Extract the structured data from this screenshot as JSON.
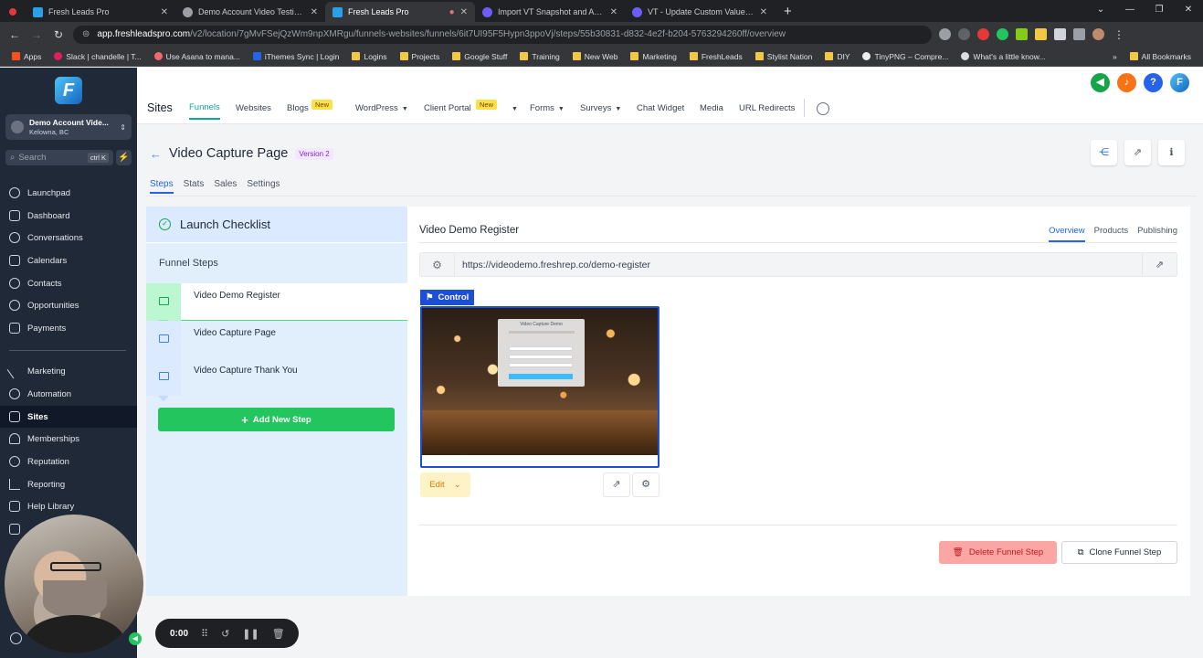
{
  "browser": {
    "tabs": [
      {
        "title": "Fresh Leads Pro",
        "active": false,
        "color": "#29a0e8"
      },
      {
        "title": "Demo Account Video Testimoni",
        "active": false,
        "color": "#9aa0a6"
      },
      {
        "title": "Fresh Leads Pro",
        "active": true,
        "color": "#29a0e8"
      },
      {
        "title": "Import VT Snapshot and Add t",
        "active": false,
        "color": "#6d5cf6"
      },
      {
        "title": "VT - Update Custom Values and",
        "active": false,
        "color": "#6d5cf6"
      }
    ],
    "url_host": "app.freshleadspro.com",
    "url_path": "/v2/location/7gMvFSejQzWm9npXMRgu/funnels-websites/funnels/6it7UI95F5Hypn3ppoVj/steps/55b30831-d832-4e2f-b204-5763294260ff/overview",
    "bookmarks": [
      "Apps",
      "Slack | chandelle | T...",
      "Use Asana to mana...",
      "iThemes Sync | Login",
      "Logins",
      "Projects",
      "Google Stuff",
      "Training",
      "New Web",
      "Marketing",
      "FreshLeads",
      "Stylist Nation",
      "DIY",
      "TinyPNG – Compre...",
      "What's a little know..."
    ],
    "bookmarks_right": "All Bookmarks"
  },
  "sidebar": {
    "account_name": "Demo Account Vide...",
    "account_location": "Kelowna, BC",
    "search_placeholder": "Search",
    "search_shortcut": "ctrl K",
    "items_top": [
      "Launchpad",
      "Dashboard",
      "Conversations",
      "Calendars",
      "Contacts",
      "Opportunities",
      "Payments"
    ],
    "items_bottom": [
      "Marketing",
      "Automation",
      "Sites",
      "Memberships",
      "Reputation",
      "Reporting",
      "Help Library"
    ],
    "active": "Sites"
  },
  "topnav": {
    "brand": "Sites",
    "items": {
      "funnels": "Funnels",
      "websites": "Websites",
      "blogs": "Blogs",
      "wordpress": "WordPress",
      "client_portal": "Client Portal",
      "forms": "Forms",
      "surveys": "Surveys",
      "chat_widget": "Chat Widget",
      "media": "Media",
      "url_redirects": "URL Redirects"
    },
    "new_badge": "New"
  },
  "page": {
    "title": "Video Capture Page",
    "version": "Version 2",
    "subtabs": [
      "Steps",
      "Stats",
      "Sales",
      "Settings"
    ]
  },
  "steps_panel": {
    "checklist_title": "Launch Checklist",
    "funnel_steps_title": "Funnel Steps",
    "steps": [
      "Video Demo Register",
      "Video Capture Page",
      "Video Capture Thank You"
    ],
    "add_step": "Add New Step"
  },
  "detail": {
    "title": "Video Demo Register",
    "tabs": [
      "Overview",
      "Products",
      "Publishing"
    ],
    "url": "https://videodemo.freshrep.co/demo-register",
    "control_label": "Control",
    "preview_heading": "Video Capture Demo",
    "edit_label": "Edit",
    "delete_label": "Delete Funnel Step",
    "clone_label": "Clone Funnel Step"
  },
  "recorder": {
    "time": "0:00"
  }
}
